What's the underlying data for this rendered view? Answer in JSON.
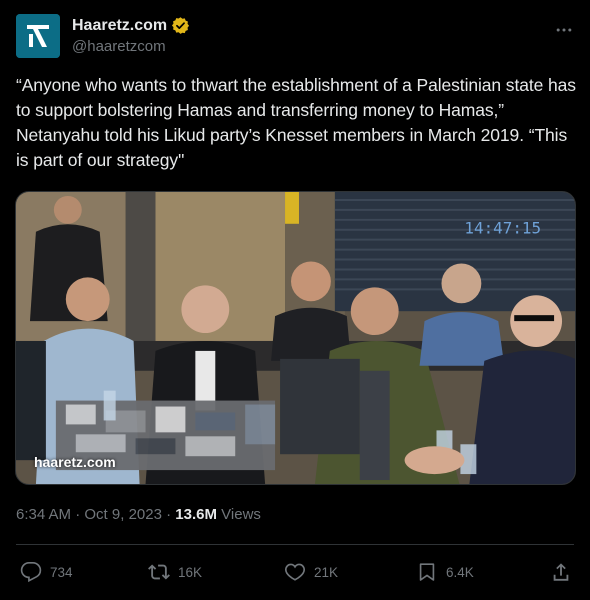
{
  "author": {
    "display_name": "Haaretz.com",
    "handle": "@haaretzcom",
    "avatar_icon": "haaretz-logo-icon",
    "verified_icon": "verified-gold-badge-icon",
    "verified_color": "#f4b400"
  },
  "tweet": {
    "text": "“Anyone who wants to thwart the establishment of a Palestinian state has to support bolstering Hamas and transferring money to Hamas,” Netanyahu told his Likud party’s Knesset members in March 2019. “This is part of our strategy\"",
    "media_watermark": "haaretz.com",
    "screen_clock_text": "14:47:15",
    "time": "6:34 AM",
    "separator": "·",
    "date": "Oct 9, 2023",
    "views_count": "13.6M",
    "views_label": "Views"
  },
  "actions": {
    "replies": "734",
    "reposts": "16K",
    "likes": "21K",
    "bookmarks": "6.4K"
  },
  "icons": {
    "more": "more-dots-icon",
    "reply": "reply-icon",
    "repost": "repost-icon",
    "like": "heart-icon",
    "bookmark": "bookmark-icon",
    "share": "share-icon"
  },
  "colors": {
    "background": "#000000",
    "text": "#e7e9ea",
    "muted": "#71767b",
    "border": "#2f3336",
    "avatar_bg": "#0c6d86"
  }
}
